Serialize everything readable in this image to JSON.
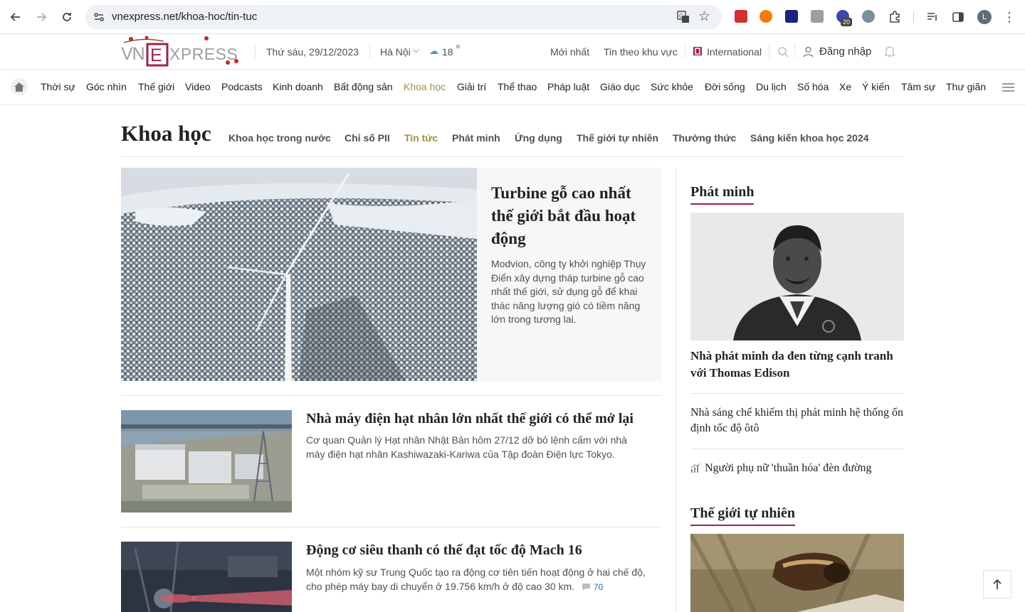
{
  "browser": {
    "url": "vnexpress.net/khoa-hoc/tin-tuc",
    "ext_badge": "20",
    "profile_initial": "L"
  },
  "header": {
    "date": "Thứ sáu, 29/12/2023",
    "city": "Hà Nội",
    "temperature": "18",
    "temp_unit": "o",
    "links": {
      "latest": "Mới nhất",
      "regional": "Tin theo khu vực",
      "international": "International",
      "login": "Đăng nhập"
    }
  },
  "nav": {
    "items": [
      "Thời sự",
      "Góc nhìn",
      "Thế giới",
      "Video",
      "Podcasts",
      "Kinh doanh",
      "Bất động sản",
      "Khoa học",
      "Giải trí",
      "Thể thao",
      "Pháp luật",
      "Giáo dục",
      "Sức khỏe",
      "Đời sống",
      "Du lịch",
      "Số hóa",
      "Xe",
      "Ý kiến",
      "Tâm sự",
      "Thư giãn"
    ],
    "active": "Khoa học"
  },
  "section": {
    "title": "Khoa học",
    "subnav": [
      "Khoa học trong nước",
      "Chỉ số PII",
      "Tin tức",
      "Phát minh",
      "Ứng dụng",
      "Thế giới tự nhiên",
      "Thường thức",
      "Sáng kiến khoa học 2024"
    ],
    "active": "Tin tức"
  },
  "featured": {
    "title": "Turbine gỗ cao nhất thế giới bắt đầu hoạt động",
    "description": "Modvion, công ty khởi nghiệp Thụy Điển xây dựng tháp turbine gỗ cao nhất thế giới, sử dụng gỗ để khai thác năng lượng gió có tiềm năng lớn trong tương lai."
  },
  "articles": [
    {
      "title": "Nhà máy điện hạt nhân lớn nhất thế giới có thể mở lại",
      "description": "Cơ quan Quản lý Hạt nhân Nhật Bản hôm 27/12 dỡ bỏ lệnh cấm với nhà máy điện hạt nhân Kashiwazaki-Kariwa của Tập đoàn Điện lực Tokyo."
    },
    {
      "title": "Động cơ siêu thanh có thể đạt tốc độ Mach 16",
      "description": "Một nhóm kỹ sư Trung Quốc tạo ra động cơ tiên tiến hoạt động ở hai chế độ, cho phép máy bay di chuyển ở 19.756 km/h ở độ cao 30 km.",
      "comments": "70"
    }
  ],
  "sidebar": {
    "invention": {
      "heading": "Phát minh",
      "lead_title": "Nhà phát minh da đen từng cạnh tranh với Thomas Edison",
      "links": [
        "Nhà sáng chế khiếm thị phát minh hệ thống ổn định tốc độ ôtô",
        "Người phụ nữ 'thuần hóa' đèn đường"
      ]
    },
    "nature": {
      "heading": "Thế giới tự nhiên"
    }
  },
  "colors": {
    "accent": "#9f224e",
    "active_nav": "#9f9040",
    "link_blue": "#076db6"
  }
}
